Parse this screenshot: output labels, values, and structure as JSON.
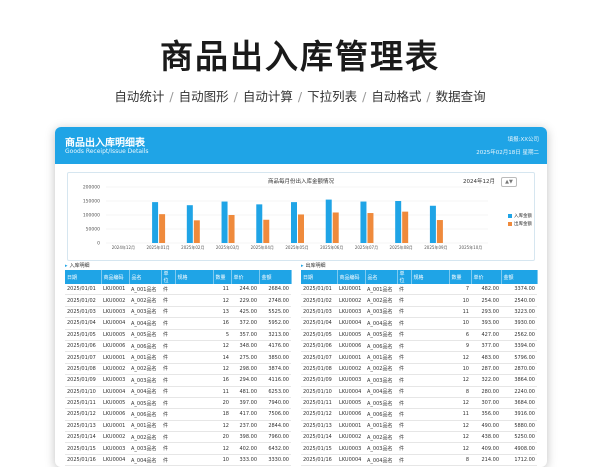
{
  "hero": {
    "title": "商品出入库管理表",
    "features": [
      "自动统计",
      "自动图形",
      "自动计算",
      "下拉列表",
      "自动格式",
      "数据查询"
    ],
    "separator": "/"
  },
  "card": {
    "title": "商品出入库明细表",
    "subtitle": "Goods Receipt/Issue Details",
    "company": "XX公司",
    "company_prefix": "填报:",
    "date": "2025年02月18日",
    "date_suffix": "星期二"
  },
  "chart": {
    "title": "商品每月份出入库金额情况",
    "month_selector": "2024年12月",
    "spinner": "▲▼"
  },
  "chart_data": {
    "type": "bar",
    "title": "商品每月份出入库金额情况",
    "categories": [
      "2024年12月",
      "2025年01月",
      "2025年02月",
      "2025年03月",
      "2025年04月",
      "2025年05月",
      "2025年06月",
      "2025年07月",
      "2025年08月",
      "2025年09月",
      "2025年10月"
    ],
    "x_labels": [
      "2024年12月",
      "2025年01月",
      "2025年02月",
      "2025年03月",
      "2025年04月",
      "2025年05月",
      "2025年06月",
      "2025年07月",
      "2025年08月",
      "2025年09月",
      "2025年10月"
    ],
    "series": [
      {
        "name": "入库金额",
        "color": "#1fa4e6",
        "values": [
          0,
          146000,
          135000,
          148000,
          138000,
          146000,
          155000,
          148000,
          150000,
          133000,
          0
        ]
      },
      {
        "name": "出库金额",
        "color": "#ef8a3c",
        "values": [
          0,
          103000,
          81000,
          100000,
          83000,
          102000,
          109000,
          107000,
          112000,
          82000,
          0
        ]
      }
    ],
    "ylim": [
      0,
      200000
    ],
    "yticks": [
      0,
      50000,
      100000,
      150000,
      200000
    ],
    "legend_position": "right",
    "grid": true
  },
  "in_section": {
    "label": "入库明细",
    "columns": [
      "日期",
      "商品编码",
      "品名",
      "单位",
      "规格",
      "数量",
      "单价",
      "金额"
    ],
    "rows": [
      [
        "2025/01/01",
        "LKU0001",
        "A_001品名",
        "件",
        "",
        "11",
        "244.00",
        "2684.00"
      ],
      [
        "2025/01/02",
        "LKU0002",
        "A_002品名",
        "件",
        "",
        "12",
        "229.00",
        "2748.00"
      ],
      [
        "2025/01/03",
        "LKU0003",
        "A_003品名",
        "件",
        "",
        "13",
        "425.00",
        "5525.00"
      ],
      [
        "2025/01/04",
        "LKU0004",
        "A_004品名",
        "件",
        "",
        "16",
        "372.00",
        "5952.00"
      ],
      [
        "2025/01/05",
        "LKU0005",
        "A_005品名",
        "件",
        "",
        "5",
        "357.00",
        "3213.00"
      ],
      [
        "2025/01/06",
        "LKU0006",
        "A_006品名",
        "件",
        "",
        "12",
        "348.00",
        "4176.00"
      ],
      [
        "2025/01/07",
        "LKU0001",
        "A_001品名",
        "件",
        "",
        "14",
        "275.00",
        "3850.00"
      ],
      [
        "2025/01/08",
        "LKU0002",
        "A_002品名",
        "件",
        "",
        "12",
        "298.00",
        "3874.00"
      ],
      [
        "2025/01/09",
        "LKU0003",
        "A_003品名",
        "件",
        "",
        "16",
        "294.00",
        "4116.00"
      ],
      [
        "2025/01/10",
        "LKU0004",
        "A_004品名",
        "件",
        "",
        "11",
        "481.00",
        "6253.00"
      ],
      [
        "2025/01/11",
        "LKU0005",
        "A_005品名",
        "件",
        "",
        "20",
        "397.00",
        "7940.00"
      ],
      [
        "2025/01/12",
        "LKU0006",
        "A_006品名",
        "件",
        "",
        "18",
        "417.00",
        "7506.00"
      ],
      [
        "2025/01/13",
        "LKU0001",
        "A_001品名",
        "件",
        "",
        "12",
        "237.00",
        "2844.00"
      ],
      [
        "2025/01/14",
        "LKU0002",
        "A_002品名",
        "件",
        "",
        "20",
        "398.00",
        "7960.00"
      ],
      [
        "2025/01/15",
        "LKU0003",
        "A_003品名",
        "件",
        "",
        "12",
        "402.00",
        "6432.00"
      ],
      [
        "2025/01/16",
        "LKU0004",
        "A_004品名",
        "件",
        "",
        "10",
        "333.00",
        "3330.00"
      ]
    ]
  },
  "out_section": {
    "label": "出库明细",
    "columns": [
      "日期",
      "商品编码",
      "品名",
      "单位",
      "规格",
      "数量",
      "单价",
      "金额"
    ],
    "rows": [
      [
        "2025/01/01",
        "LKU0001",
        "A_001品名",
        "件",
        "",
        "7",
        "482.00",
        "3374.00"
      ],
      [
        "2025/01/02",
        "LKU0002",
        "A_002品名",
        "件",
        "",
        "10",
        "254.00",
        "2540.00"
      ],
      [
        "2025/01/03",
        "LKU0003",
        "A_003品名",
        "件",
        "",
        "11",
        "293.00",
        "3223.00"
      ],
      [
        "2025/01/04",
        "LKU0004",
        "A_004品名",
        "件",
        "",
        "10",
        "393.00",
        "3930.00"
      ],
      [
        "2025/01/05",
        "LKU0005",
        "A_005品名",
        "件",
        "",
        "6",
        "427.00",
        "2562.00"
      ],
      [
        "2025/01/06",
        "LKU0006",
        "A_006品名",
        "件",
        "",
        "9",
        "377.00",
        "3394.00"
      ],
      [
        "2025/01/07",
        "LKU0001",
        "A_001品名",
        "件",
        "",
        "12",
        "483.00",
        "5796.00"
      ],
      [
        "2025/01/08",
        "LKU0002",
        "A_002品名",
        "件",
        "",
        "10",
        "287.00",
        "2870.00"
      ],
      [
        "2025/01/09",
        "LKU0003",
        "A_003品名",
        "件",
        "",
        "12",
        "322.00",
        "3864.00"
      ],
      [
        "2025/01/10",
        "LKU0004",
        "A_004品名",
        "件",
        "",
        "8",
        "280.00",
        "2240.00"
      ],
      [
        "2025/01/11",
        "LKU0005",
        "A_005品名",
        "件",
        "",
        "12",
        "307.00",
        "3684.00"
      ],
      [
        "2025/01/12",
        "LKU0006",
        "A_006品名",
        "件",
        "",
        "11",
        "356.00",
        "3916.00"
      ],
      [
        "2025/01/13",
        "LKU0001",
        "A_001品名",
        "件",
        "",
        "12",
        "490.00",
        "5880.00"
      ],
      [
        "2025/01/14",
        "LKU0002",
        "A_002品名",
        "件",
        "",
        "12",
        "438.00",
        "5250.00"
      ],
      [
        "2025/01/15",
        "LKU0003",
        "A_003品名",
        "件",
        "",
        "12",
        "409.00",
        "4908.00"
      ],
      [
        "2025/01/16",
        "LKU0004",
        "A_004品名",
        "件",
        "",
        "8",
        "214.00",
        "1712.00"
      ]
    ]
  }
}
